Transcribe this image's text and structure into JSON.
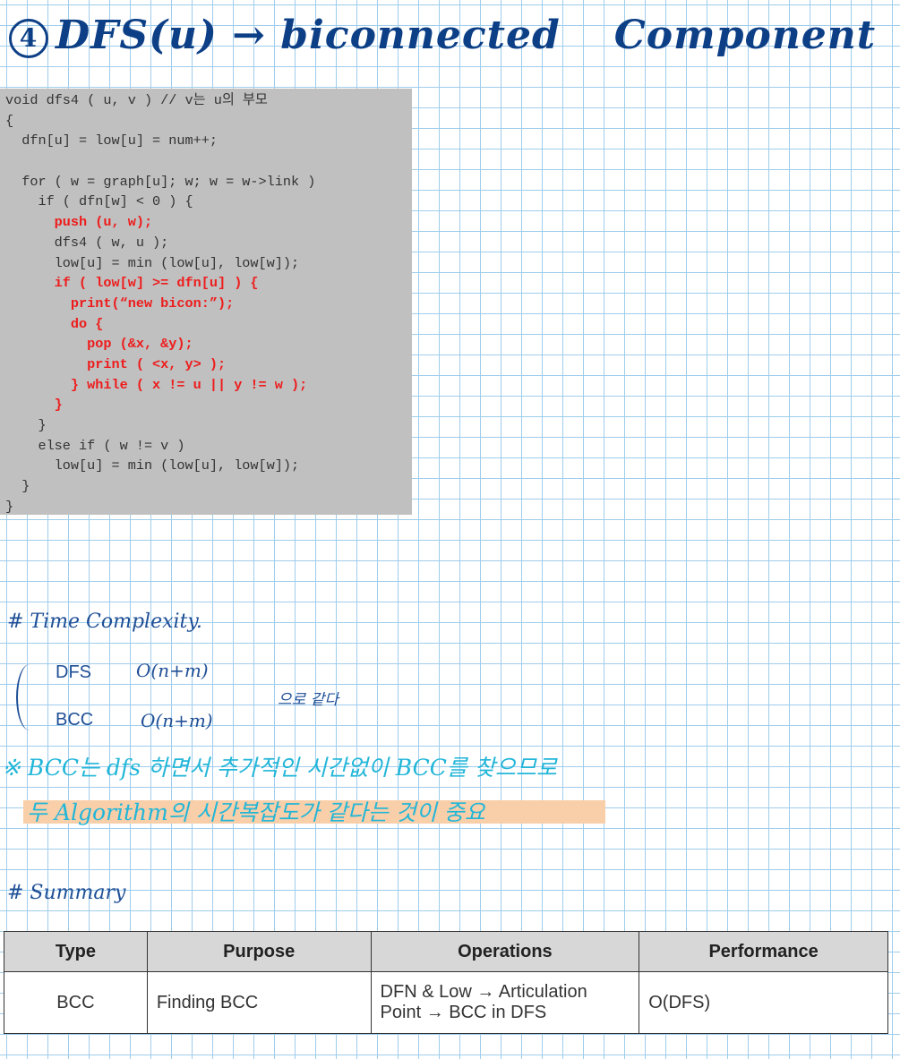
{
  "title": {
    "number": "4",
    "text": "DFS(u) → biconnected",
    "text2": "Component"
  },
  "code": {
    "lines": [
      {
        "t": "void dfs4 ( u, v ) // v는 u의 부모",
        "red": false
      },
      {
        "t": "{",
        "red": false
      },
      {
        "t": "  dfn[u] = low[u] = num++;",
        "red": false
      },
      {
        "t": "",
        "red": false
      },
      {
        "t": "  for ( w = graph[u]; w; w = w->link )",
        "red": false
      },
      {
        "t": "    if ( dfn[w] < 0 ) {",
        "red": false
      },
      {
        "t": "      push (u, w);",
        "red": true
      },
      {
        "t": "      dfs4 ( w, u );",
        "red": false
      },
      {
        "t": "      low[u] = min (low[u], low[w]);",
        "red": false
      },
      {
        "t": "      if ( low[w] >= dfn[u] ) {",
        "red": true
      },
      {
        "t": "        print(“new bicon:”);",
        "red": true
      },
      {
        "t": "        do {",
        "red": true
      },
      {
        "t": "          pop (&x, &y);",
        "red": true
      },
      {
        "t": "          print ( <x, y> );",
        "red": true
      },
      {
        "t": "        } while ( x != u || y != w );",
        "red": true
      },
      {
        "t": "      }",
        "red": true
      },
      {
        "t": "    }",
        "red": false
      },
      {
        "t": "    else if ( w != v )",
        "red": false
      },
      {
        "t": "      low[u] = min (low[u], low[w]);",
        "red": false
      },
      {
        "t": "  }",
        "red": false
      },
      {
        "t": "}",
        "red": false
      }
    ]
  },
  "time_complexity": {
    "heading": "# Time Complexity.",
    "dfs_label": "DFS",
    "dfs_value": "O(n+m)",
    "bcc_label": "BCC",
    "bcc_value": "O(n+m)",
    "same_text": "으로  같다",
    "note_line1": "※ BCC는 dfs 하면서 추가적인 시간없이 BCC를 찾으므로",
    "note_line2": "두 Algorithm의 시간복잡도가 같다는 것이 중요"
  },
  "summary": {
    "heading": "# Summary",
    "headers": [
      "Type",
      "Purpose",
      "Operations",
      "Performance"
    ],
    "row": [
      "BCC",
      "Finding BCC",
      "DFN & Low → Articulation Point → BCC in DFS",
      "O(DFS)"
    ]
  }
}
